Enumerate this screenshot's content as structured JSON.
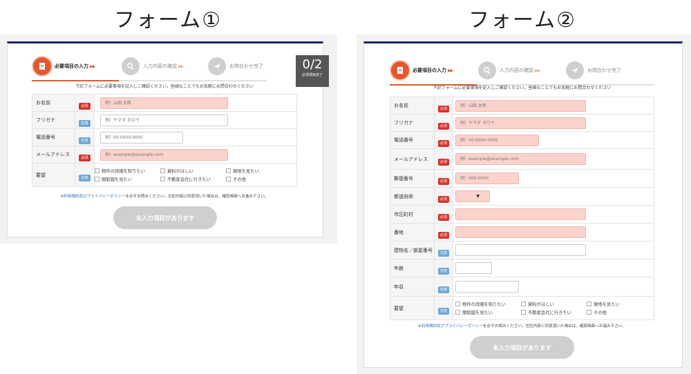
{
  "headings": {
    "form1": "フォーム①",
    "form2": "フォーム②"
  },
  "steps": {
    "step1": "必要項目の入力",
    "step2": "入力内容の確認",
    "step3": "お問合わせ完了",
    "arrow": "▶▶"
  },
  "counter": {
    "value": "0/2",
    "caption": "必須項目完了"
  },
  "intro": "下記フォームに必要事項を記入しご確認ください。些細なことでもお気軽にお問合わせください",
  "badges": {
    "required": "必須",
    "optional": "任意"
  },
  "form1": {
    "name": {
      "label": "お名前",
      "placeholder": "例）山田 太郎"
    },
    "kana": {
      "label": "フリガナ",
      "placeholder": "例）ヤマダ タロウ"
    },
    "phone": {
      "label": "電話番号",
      "placeholder": "例）00-0000-0000"
    },
    "email": {
      "label": "メールアドレス",
      "placeholder": "例）example@example.com"
    },
    "request": {
      "label": "要望",
      "options": [
        "物件の詳細を知りたい",
        "資料がほしい",
        "現地を見たい",
        "間取図を見たい",
        "不動産会社に行きたい",
        "その他"
      ]
    }
  },
  "form2": {
    "name": {
      "label": "お名前",
      "placeholder": "例）山田 太郎"
    },
    "kana": {
      "label": "フリガナ",
      "placeholder": "例）ヤマダ タロウ"
    },
    "phone": {
      "label": "電話番号",
      "placeholder": "例）00-0000-0000"
    },
    "email": {
      "label": "メールアドレス",
      "placeholder": "例）example@example.com"
    },
    "zip": {
      "label": "郵便番号",
      "placeholder": "例）000-0000"
    },
    "prefecture": {
      "label": "都道府県",
      "value": "▼"
    },
    "city": {
      "label": "市区町村"
    },
    "address": {
      "label": "番地"
    },
    "building": {
      "label": "建物名／部屋番号"
    },
    "age": {
      "label": "年齢"
    },
    "income": {
      "label": "年収"
    },
    "request": {
      "label": "要望",
      "options": [
        "物件の詳細を知りたい",
        "資料がほしい",
        "現地を見たい",
        "間取図を見たい",
        "不動産会社に行きたい",
        "その他"
      ]
    }
  },
  "notice": {
    "prefix": "※",
    "link": "利用規約及びプライバシーポリシー",
    "suffix": "を必ずお読みください。左記内容に同意頂いた場合は、確認画面へお進み下さい。"
  },
  "submit": "未入力項目があります",
  "colors": {
    "accent": "#e4572e",
    "navy": "#23246a",
    "required": "#d9332b",
    "optional": "#6fa8d6",
    "pinkField": "#fbd3cc",
    "disabledButton": "#cfcfcf"
  }
}
